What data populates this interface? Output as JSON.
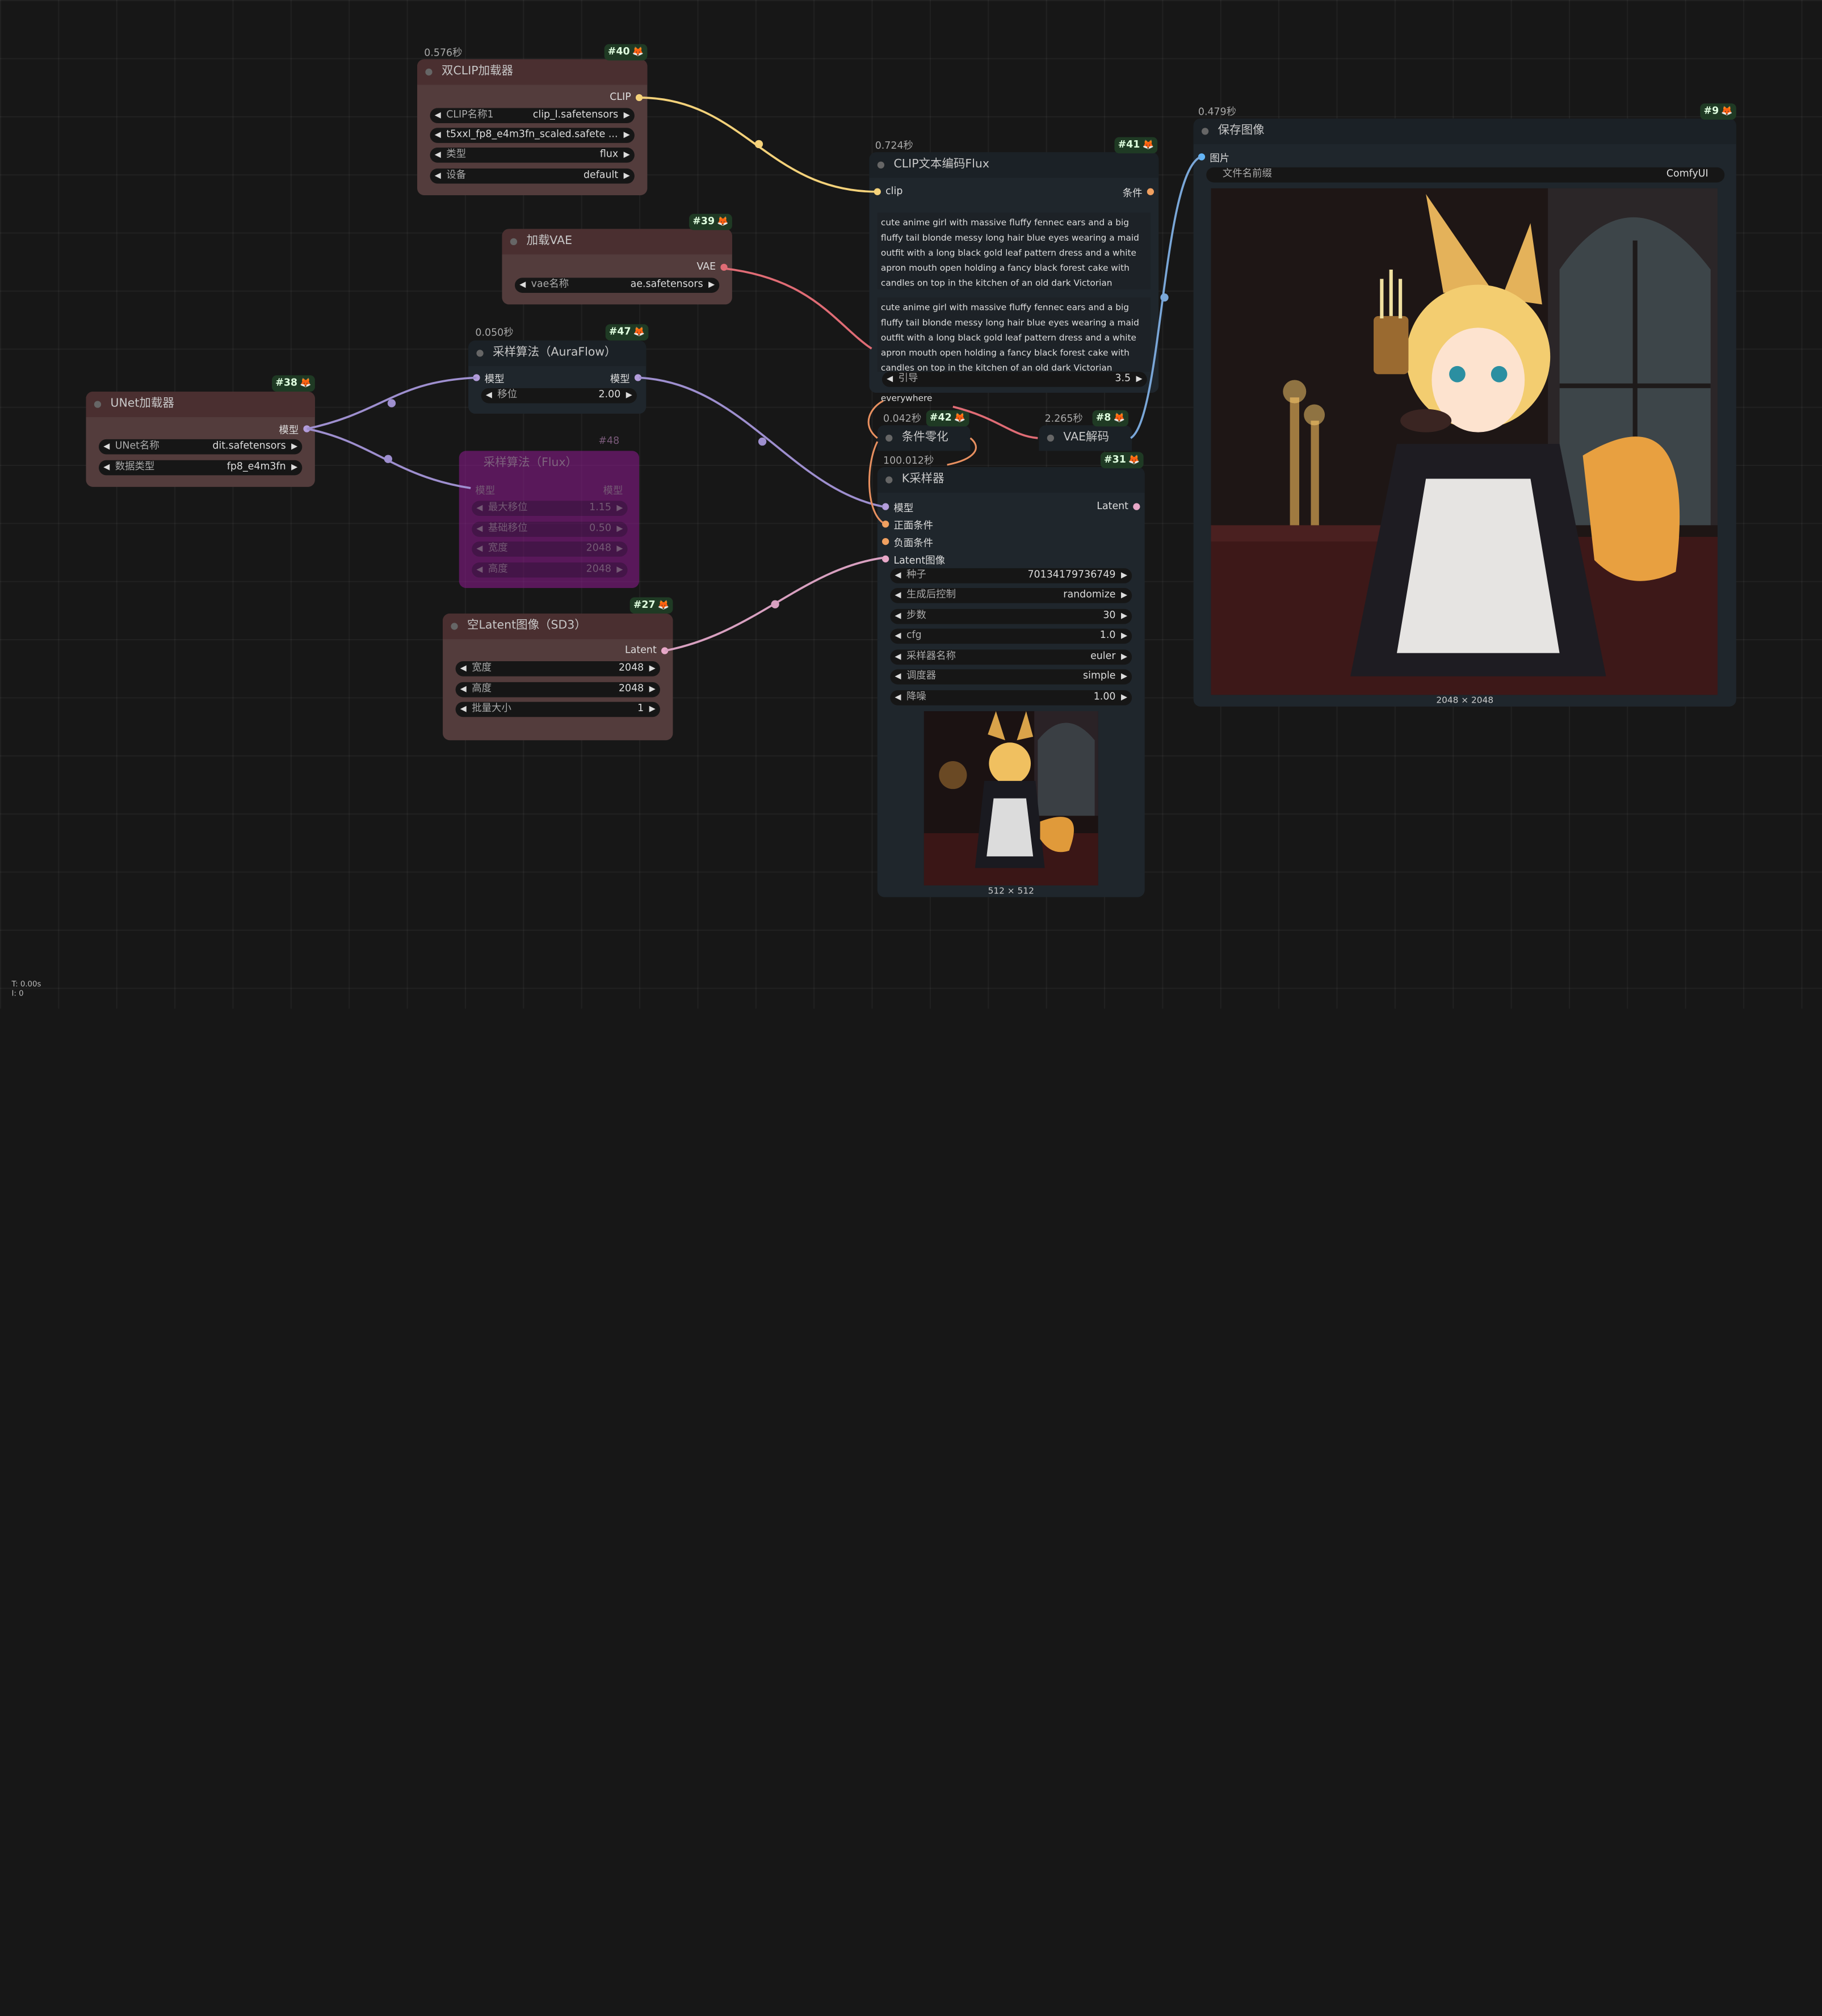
{
  "nodes": {
    "dual_clip": {
      "id": "#40",
      "timer": "0.576秒",
      "title": "双CLIP加载器",
      "output": "CLIP",
      "widgets": [
        {
          "label": "CLIP名称1",
          "value": "clip_l.safetensors"
        },
        {
          "label": "",
          "value": "t5xxl_fp8_e4m3fn_scaled.safete ..."
        },
        {
          "label": "类型",
          "value": "flux"
        },
        {
          "label": "设备",
          "value": "default"
        }
      ]
    },
    "vae_loader": {
      "id": "#39",
      "title": "加载VAE",
      "output": "VAE",
      "widgets": [
        {
          "label": "vae名称",
          "value": "ae.safetensors"
        }
      ]
    },
    "unet_loader": {
      "id": "#38",
      "title": "UNet加载器",
      "output": "模型",
      "widgets": [
        {
          "label": "UNet名称",
          "value": "dit.safetensors"
        },
        {
          "label": "数据类型",
          "value": "fp8_e4m3fn"
        }
      ]
    },
    "auraflow": {
      "id": "#47",
      "timer": "0.050秒",
      "title": "采样算法（AuraFlow）",
      "input": "模型",
      "output": "模型",
      "widgets": [
        {
          "label": "移位",
          "value": "2.00"
        }
      ]
    },
    "flux_sampling": {
      "id": "#48",
      "title": "采样算法（Flux）",
      "input": "模型",
      "output": "模型",
      "widgets": [
        {
          "label": "最大移位",
          "value": "1.15"
        },
        {
          "label": "基础移位",
          "value": "0.50"
        },
        {
          "label": "宽度",
          "value": "2048"
        },
        {
          "label": "高度",
          "value": "2048"
        }
      ]
    },
    "empty_latent": {
      "id": "#27",
      "title": "空Latent图像（SD3）",
      "output": "Latent",
      "widgets": [
        {
          "label": "宽度",
          "value": "2048"
        },
        {
          "label": "高度",
          "value": "2048"
        },
        {
          "label": "批量大小",
          "value": "1"
        }
      ]
    },
    "clip_text": {
      "id": "#41",
      "timer": "0.724秒",
      "title": "CLIP文本编码Flux",
      "input": "clip",
      "output": "条件",
      "text1": "cute anime girl with massive fluffy fennec ears and a big fluffy tail blonde messy long hair blue eyes wearing a maid outfit with a long black gold leaf pattern dress and a white apron mouth open holding a fancy black forest cake with candles on top in the kitchen of an old dark Victorian mansion lit by candlelight with a",
      "text2": "cute anime girl with massive fluffy fennec ears and a big fluffy tail blonde messy long hair blue eyes wearing a maid outfit with a long black gold leaf pattern dress and a white apron mouth open holding a fancy black forest cake with candles on top in the kitchen of an old dark Victorian mansion lit by candlelight with a",
      "guidance_label": "引导",
      "guidance_value": "3.5",
      "overflow_text": "everywhere"
    },
    "cond_zero": {
      "id": "#42",
      "timer": "0.042秒",
      "title": "条件零化"
    },
    "vae_decode": {
      "id": "#8",
      "timer": "2.265秒",
      "title": "VAE解码"
    },
    "ksampler": {
      "id": "#31",
      "timer": "100.012秒",
      "title": "K采样器",
      "inputs": [
        "模型",
        "正面条件",
        "负面条件",
        "Latent图像"
      ],
      "output": "Latent",
      "widgets": [
        {
          "label": "种子",
          "value": "70134179736749"
        },
        {
          "label": "生成后控制",
          "value": "randomize"
        },
        {
          "label": "步数",
          "value": "30"
        },
        {
          "label": "cfg",
          "value": "1.0"
        },
        {
          "label": "采样器名称",
          "value": "euler"
        },
        {
          "label": "调度器",
          "value": "simple"
        },
        {
          "label": "降噪",
          "value": "1.00"
        }
      ],
      "preview_caption": "512 × 512"
    },
    "save_image": {
      "id": "#9",
      "timer": "0.479秒",
      "title": "保存图像",
      "input": "图片",
      "widgets": [
        {
          "label": "文件名前缀",
          "value": "ComfyUI"
        }
      ],
      "preview_caption": "2048 × 2048"
    }
  },
  "stats": {
    "line1": "T: 0.00s",
    "line2": "I: 0"
  },
  "colors": {
    "clip": "#f5d27a",
    "vae": "#e06c75",
    "model": "#b39ddb",
    "latent": "#e8a8c8",
    "conditioning": "#f0a060",
    "image": "#64b5f6"
  }
}
